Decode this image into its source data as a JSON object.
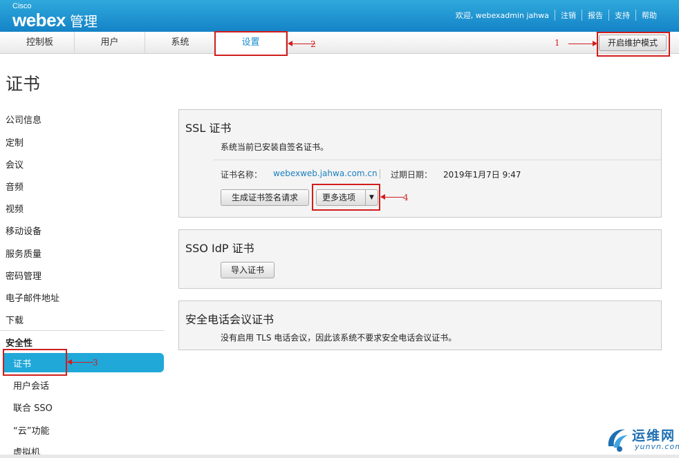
{
  "header": {
    "brand_small": "Cisco",
    "brand": "webex",
    "product": "管理",
    "welcome": "欢迎, webexadmin jahwa",
    "links": [
      "注销",
      "报告",
      "支持",
      "帮助"
    ]
  },
  "nav": {
    "tabs": [
      "控制板",
      "用户",
      "系统",
      "设置"
    ],
    "active_tab": "设置",
    "maintenance_button": "开启维护模式"
  },
  "page": {
    "title": "证书"
  },
  "sidebar": {
    "items": [
      "公司信息",
      "定制",
      "会议",
      "音频",
      "视频",
      "移动设备",
      "服务质量",
      "密码管理",
      "电子邮件地址",
      "下载"
    ],
    "section_heading": "安全性",
    "sub_items": [
      "证书",
      "用户会话",
      "联合 SSO",
      "“云”功能",
      "虚拟机"
    ],
    "active_sub_item": "证书"
  },
  "ssl_panel": {
    "title": "SSL 证书",
    "status": "系统当前已安装自签名证书。",
    "cert_name_label": "证书名称：",
    "cert_name_value": "webexweb.jahwa.com.cn",
    "expiry_label": "过期日期：",
    "expiry_value": "2019年1月7日 9:47",
    "csr_button": "生成证书签名请求",
    "more_button": "更多选项",
    "caret": "▼"
  },
  "sso_panel": {
    "title": "SSO IdP 证书",
    "import_button": "导入证书"
  },
  "secure_panel": {
    "title": "安全电话会议证书",
    "text": "没有启用 TLS 电话会议，因此该系统不要求安全电话会议证书。"
  },
  "annotations": {
    "n1": "1",
    "n2": "2",
    "n3": "3",
    "n4": "4"
  },
  "watermark": {
    "cn": "运维网",
    "en": "yunvn.com"
  },
  "colors": {
    "header_blue": "#1b92d2",
    "active_blue": "#20a8d8",
    "annotation_red": "#d11c1c",
    "link_blue": "#1a7fc0"
  }
}
